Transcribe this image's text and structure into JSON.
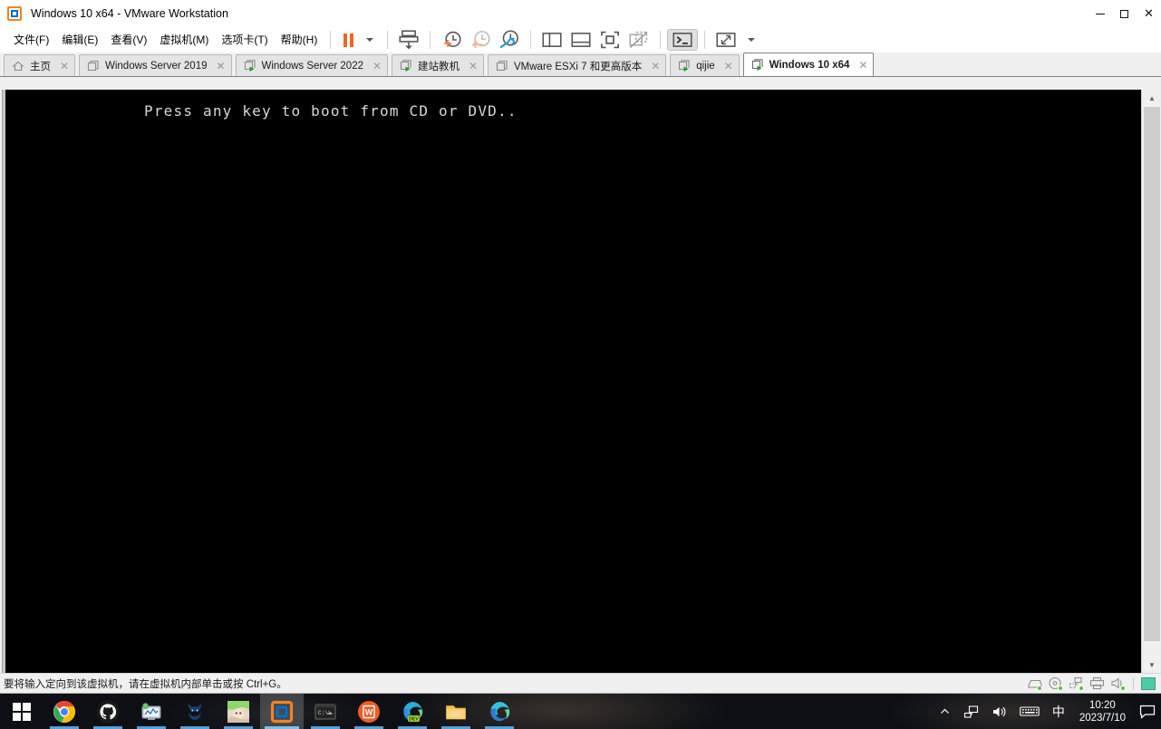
{
  "window": {
    "title": "Windows 10 x64 - VMware Workstation",
    "app_icon": "vmware-logo-icon",
    "controls": {
      "minimize": "minimize-icon",
      "maximize": "maximize-icon",
      "close": "close-icon"
    }
  },
  "menu": {
    "items": [
      {
        "label": "文件(F)",
        "name": "menu-file"
      },
      {
        "label": "编辑(E)",
        "name": "menu-edit"
      },
      {
        "label": "查看(V)",
        "name": "menu-view"
      },
      {
        "label": "虚拟机(M)",
        "name": "menu-vm"
      },
      {
        "label": "选项卡(T)",
        "name": "menu-tabs"
      },
      {
        "label": "帮助(H)",
        "name": "menu-help"
      }
    ]
  },
  "toolbar": {
    "buttons": [
      {
        "name": "suspend-button",
        "icon": "pause-icon",
        "tooltip": "挂起"
      },
      {
        "name": "power-dropdown",
        "icon": "chevron-down-icon",
        "tooltip": "电源"
      },
      {
        "name": "send-ctrl-alt-del-button",
        "icon": "send-key-icon",
        "tooltip": "发送组合键"
      },
      {
        "name": "take-snapshot-button",
        "icon": "snapshot-add-icon",
        "tooltip": "拍摄此虚拟机的快照"
      },
      {
        "name": "revert-snapshot-button",
        "icon": "snapshot-revert-icon",
        "tooltip": "恢复至快照"
      },
      {
        "name": "snapshot-manager-button",
        "icon": "snapshot-manager-icon",
        "tooltip": "管理快照"
      },
      {
        "name": "show-library-button",
        "icon": "library-panel-icon",
        "tooltip": "显示或隐藏库"
      },
      {
        "name": "show-thumbnails-button",
        "icon": "thumbnail-bar-icon",
        "tooltip": "显示或隐藏缩略图"
      },
      {
        "name": "fullscreen-button",
        "icon": "fullscreen-icon",
        "tooltip": "进入全屏模式"
      },
      {
        "name": "unity-mode-button",
        "icon": "unity-mode-disabled-icon",
        "tooltip": "Unity 模式"
      },
      {
        "name": "console-view-button",
        "icon": "console-view-icon",
        "tooltip": "控制台视图"
      },
      {
        "name": "stretch-guest-button",
        "icon": "stretch-guest-icon",
        "tooltip": "自由伸展客户机"
      },
      {
        "name": "stretch-dropdown",
        "icon": "chevron-down-icon",
        "tooltip": "更多"
      }
    ]
  },
  "tabs": [
    {
      "label": "主页",
      "icon": "home-icon",
      "active": false,
      "closable": true,
      "name": "tab-home"
    },
    {
      "label": "Windows Server 2019",
      "icon": "vm-powered-off-icon",
      "active": false,
      "closable": true,
      "name": "tab-windows-server-2019"
    },
    {
      "label": "Windows Server 2022",
      "icon": "vm-running-icon",
      "active": false,
      "closable": true,
      "name": "tab-windows-server-2022"
    },
    {
      "label": "建站教机",
      "icon": "vm-running-icon",
      "active": false,
      "closable": true,
      "name": "tab-jianzhanjiaoji"
    },
    {
      "label": "VMware ESXi 7 和更高版本",
      "icon": "vm-powered-off-icon",
      "active": false,
      "closable": true,
      "name": "tab-vmware-esxi-7"
    },
    {
      "label": "qijie",
      "icon": "vm-running-icon",
      "active": false,
      "closable": true,
      "name": "tab-qijie"
    },
    {
      "label": "Windows 10 x64",
      "icon": "vm-running-icon",
      "active": true,
      "closable": true,
      "name": "tab-windows-10-x64"
    }
  ],
  "vm_screen": {
    "boot_text": "Press any key to boot from CD or DVD..",
    "background": "#000000",
    "text_color": "#d8d8d8"
  },
  "scrollbar": {
    "up_arrow": "scroll-up-icon",
    "down_arrow": "scroll-down-icon"
  },
  "statusbar": {
    "message": "要将输入定向到该虚拟机，请在虚拟机内部单击或按 Ctrl+G。",
    "devices": [
      {
        "name": "status-hard-disk-icon",
        "label": "硬盘"
      },
      {
        "name": "status-cd-dvd-icon",
        "label": "CD/DVD"
      },
      {
        "name": "status-network-icon",
        "label": "网络适配器"
      },
      {
        "name": "status-printer-icon",
        "label": "打印机"
      },
      {
        "name": "status-sound-icon",
        "label": "声卡"
      },
      {
        "name": "status-display-icon",
        "label": "显示器"
      }
    ]
  },
  "taskbar": {
    "start": {
      "name": "start-button",
      "icon": "windows-logo-icon"
    },
    "apps": [
      {
        "name": "taskbar-chrome",
        "icon": "chrome-icon",
        "running": true,
        "active": false
      },
      {
        "name": "taskbar-github",
        "icon": "github-icon",
        "running": true,
        "active": false
      },
      {
        "name": "taskbar-monitor",
        "icon": "monitor-chart-icon",
        "running": true,
        "active": false
      },
      {
        "name": "taskbar-cat-app",
        "icon": "cat-icon",
        "running": true,
        "active": false
      },
      {
        "name": "taskbar-avatar-app",
        "icon": "anime-avatar-icon",
        "running": true,
        "active": false
      },
      {
        "name": "taskbar-vmware",
        "icon": "vmware-logo-icon",
        "running": true,
        "active": true
      },
      {
        "name": "taskbar-terminal",
        "icon": "terminal-icon",
        "running": true,
        "active": false
      },
      {
        "name": "taskbar-wps",
        "icon": "wps-writer-icon",
        "running": true,
        "active": false
      },
      {
        "name": "taskbar-edge-dev",
        "icon": "edge-dev-icon",
        "running": true,
        "active": false
      },
      {
        "name": "taskbar-explorer",
        "icon": "file-explorer-icon",
        "running": true,
        "active": false
      },
      {
        "name": "taskbar-edge",
        "icon": "edge-icon",
        "running": true,
        "active": false
      }
    ],
    "tray": {
      "overflow": {
        "name": "tray-overflow-button",
        "icon": "chevron-up-icon"
      },
      "network": {
        "name": "tray-network-button",
        "icon": "network-icon"
      },
      "volume": {
        "name": "tray-volume-button",
        "icon": "speaker-icon"
      },
      "keyboard": {
        "name": "tray-keyboard-button",
        "icon": "keyboard-icon"
      },
      "ime": {
        "name": "tray-ime-button",
        "label": "中"
      },
      "clock": {
        "time": "10:20",
        "date": "2023/7/10"
      },
      "action_center": {
        "name": "action-center-button",
        "icon": "speech-bubble-icon"
      }
    }
  }
}
